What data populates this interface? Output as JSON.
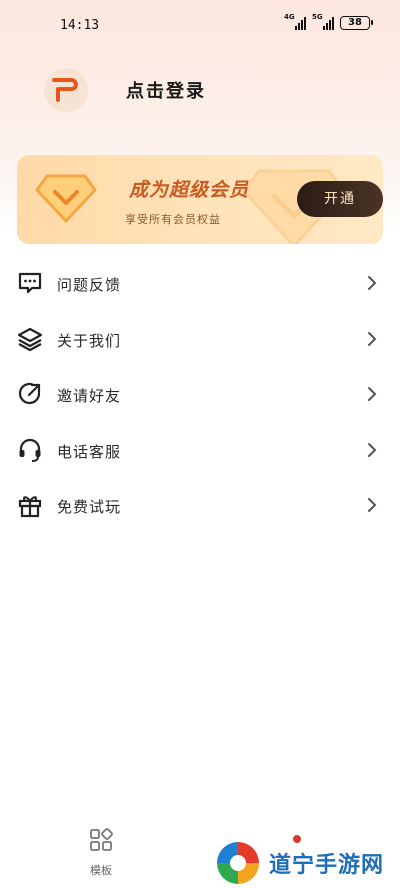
{
  "status_bar": {
    "time": "14:13",
    "network_1": "4G",
    "network_2": "5G",
    "battery": "38"
  },
  "profile": {
    "login_text": "点击登录"
  },
  "vip": {
    "title": "成为超级会员",
    "subtitle": "享受所有会员权益",
    "button_label": "开通",
    "colors": {
      "title": "#c85b22",
      "button_bg": "#2b1c15",
      "button_text": "#ffe4c0"
    }
  },
  "menu": {
    "items": [
      {
        "label": "问题反馈",
        "icon": "chat-bubble-icon"
      },
      {
        "label": "关于我们",
        "icon": "layers-icon"
      },
      {
        "label": "邀请好友",
        "icon": "share-arrow-icon"
      },
      {
        "label": "电话客服",
        "icon": "headset-icon"
      },
      {
        "label": "免费试玩",
        "icon": "gift-icon"
      }
    ]
  },
  "tabbar": {
    "templates_label": "模板"
  },
  "watermark": {
    "text": "道宁手游网"
  }
}
